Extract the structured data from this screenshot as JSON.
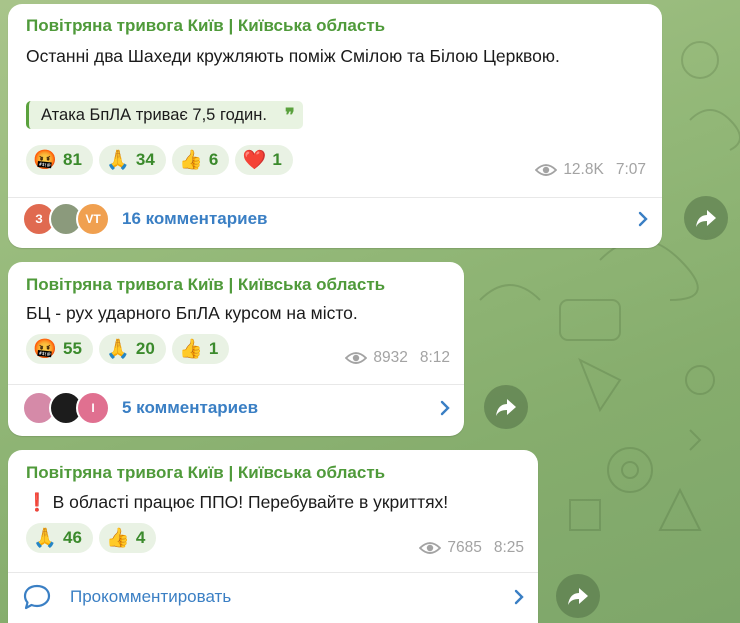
{
  "colors": {
    "channel": "#4f9a3a",
    "comment": "#3a7fc4",
    "meta": "#a3a3a3",
    "reaction_bg": "#e9f2e4"
  },
  "posts": [
    {
      "channel": "Повітряна тривога Київ | Київська область",
      "text": "Останні два Шахеди кружляють поміж Смілою та Білою Церквою.",
      "quote": "Атака БпЛА триває 7,5 годин.",
      "reactions": [
        {
          "icon": "angry-face-icon",
          "emoji": "🤬",
          "count": "81"
        },
        {
          "icon": "folded-hands-icon",
          "emoji": "🙏",
          "count": "34"
        },
        {
          "icon": "thumbs-up-icon",
          "emoji": "👍",
          "count": "6"
        },
        {
          "icon": "red-heart-icon",
          "emoji": "❤️",
          "count": "1"
        }
      ],
      "views": "12.8K",
      "time": "7:07",
      "comments": {
        "label": "16 комментариев",
        "avatars": [
          {
            "letter": "З",
            "color": "#e06a50"
          },
          {
            "letter": "",
            "color": "#8b9a7c"
          },
          {
            "letter": "VT",
            "color": "#f0a050"
          }
        ]
      }
    },
    {
      "channel": "Повітряна тривога Київ | Київська область",
      "text": "БЦ - рух ударного БпЛА курсом на місто.",
      "reactions": [
        {
          "icon": "angry-face-icon",
          "emoji": "🤬",
          "count": "55"
        },
        {
          "icon": "folded-hands-icon",
          "emoji": "🙏",
          "count": "20"
        },
        {
          "icon": "thumbs-up-icon",
          "emoji": "👍",
          "count": "1"
        }
      ],
      "views": "8932",
      "time": "8:12",
      "comments": {
        "label": "5 комментариев",
        "avatars": [
          {
            "letter": "",
            "color": "#d58aa8"
          },
          {
            "letter": "",
            "color": "#1c1c1c"
          },
          {
            "letter": "І",
            "color": "#e07090"
          }
        ]
      }
    },
    {
      "channel": "Повітряна тривога Київ | Київська область",
      "text": "❗ В області працює ППО!   Перебувайте в укриттях!",
      "reactions": [
        {
          "icon": "folded-hands-icon",
          "emoji": "🙏",
          "count": "46"
        },
        {
          "icon": "thumbs-up-icon",
          "emoji": "👍",
          "count": "4"
        }
      ],
      "views": "7685",
      "time": "8:25",
      "comments": {
        "label": "Прокомментировать"
      }
    }
  ]
}
